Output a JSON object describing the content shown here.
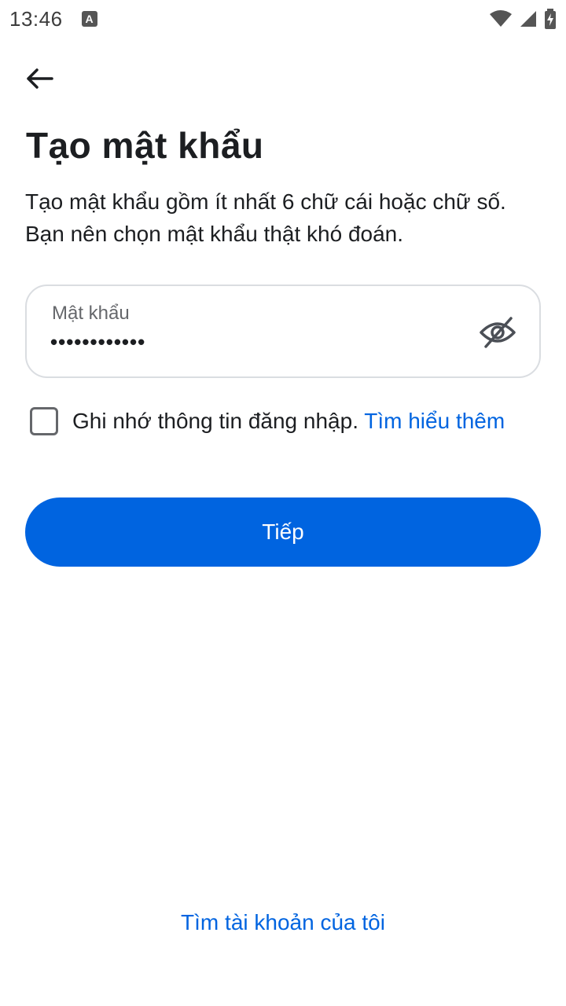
{
  "status_bar": {
    "time": "13:46",
    "notification_icon": "A",
    "icons": [
      "wifi-icon",
      "signal-icon",
      "battery-charging-icon"
    ]
  },
  "header": {
    "back_icon": "arrow-left-icon",
    "title": "Tạo mật khẩu",
    "description": "Tạo mật khẩu gồm ít nhất 6 chữ cái hoặc chữ số. Bạn nên chọn mật khẩu thật khó đoán."
  },
  "password": {
    "label": "Mật khẩu",
    "value": "••••••••••••",
    "visibility_icon": "eye-off-icon"
  },
  "remember": {
    "checked": false,
    "text": "Ghi nhớ thông tin đăng nhập. ",
    "link": "Tìm hiểu thêm"
  },
  "actions": {
    "next_label": "Tiếp",
    "find_account_label": "Tìm tài khoản của tôi"
  },
  "colors": {
    "primary": "#0064e0",
    "text": "#1c1e21",
    "secondary_text": "#65676b",
    "border": "#dadde1"
  }
}
